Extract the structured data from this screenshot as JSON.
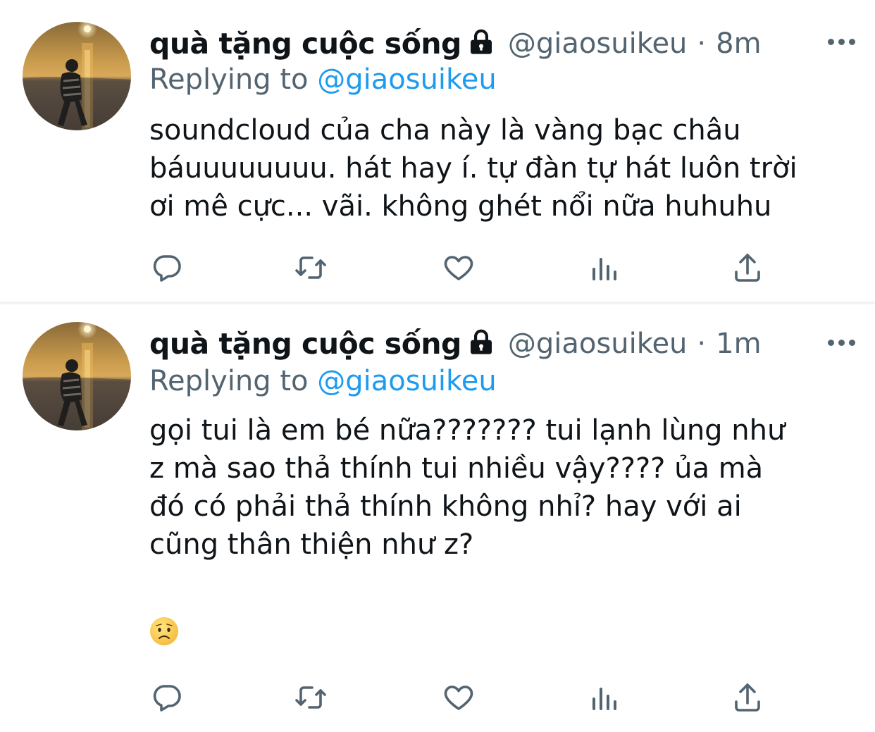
{
  "tweets": [
    {
      "display_name": "quà tặng cuộc sống",
      "handle": "@giaosuikeu",
      "separator": "·",
      "time": "8m",
      "replying_prefix": "Replying to",
      "replying_to": "@giaosuikeu",
      "text": "soundcloud của cha này là vàng bạc châu\nbáuuuuuuuu. hát hay í. tự đàn tự hát luôn trời\nơi mê cực... vãi. không ghét nổi nữa huhuhu",
      "protected_icon": "lock-icon",
      "icons": [
        "reply-icon",
        "retweet-icon",
        "like-icon",
        "stats-icon",
        "share-icon"
      ]
    },
    {
      "display_name": "quà tặng cuộc sống",
      "handle": "@giaosuikeu",
      "separator": "·",
      "time": "1m",
      "replying_prefix": "Replying to",
      "replying_to": "@giaosuikeu",
      "text": "gọi tui là em bé nữa??????? tui lạnh lùng như\nz mà sao thả thính tui nhiều vậy???? ủa mà\nđó có phải thả thính không nhỉ? hay với ai\ncũng thân thiện như z?",
      "emoji": "worried-face",
      "protected_icon": "lock-icon",
      "icons": [
        "reply-icon",
        "retweet-icon",
        "like-icon",
        "stats-icon",
        "share-icon"
      ]
    }
  ],
  "colors": {
    "text": "#0f1419",
    "secondary": "#536471",
    "link": "#1d9bf0",
    "divider": "#eff3f4"
  }
}
